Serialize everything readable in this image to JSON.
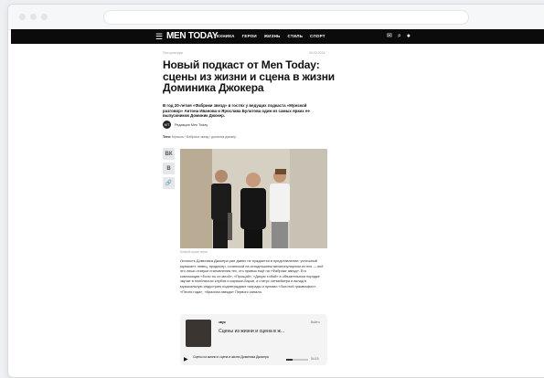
{
  "site": {
    "logo": "MEN TODAY",
    "menu": [
      "ТЕХНИКА",
      "ГЕРОИ",
      "ЖИЗНЬ",
      "СТИЛЬ",
      "СПОРТ"
    ]
  },
  "icons": {
    "burger": "menu-icon",
    "mail": "mail-icon",
    "search": "search-icon",
    "user": "user-icon"
  },
  "article": {
    "breadcrumb": "Поп-культура",
    "date": "09.03.2024",
    "title": "Новый подкаст от Men Today: сцены из жизни и сцена в жизни Доминика Джокера",
    "lead": "В год 20-летия «Фабрики звезд» в гостях у ведущих подкаста «Мужской разговор» Антона Иванова и Ярослава Булатова один из самых ярких ее выпускников Доминик Джокер.",
    "author_initials": "MT",
    "author": "Редакция Men Today",
    "tags_label": "Теги:",
    "tags": "Музыка / Фабрика звезд / доминик джокер",
    "photo_caption": "Личный архив героя",
    "body": "Личность Доминика Джокера уже давно не нуждается в представлении: успешный музыкант, певец, продюсер, сочинской на сегодняшнем мегапопулярном из них — всё это лишь отзвуки становления тех, кто привык ещё на «Фабрике звезд». Его композиции «Если ты со мной», «Прощай», «Дикую тобой» в обязательном порядке звучат в плейлистах клубов и караоке-баров, а статус хитмейкера и вклад в музыкальную индустрию подтверждают награды и премии «Золотой граммофон», «Песня года», «Красная звезда» Первого канала."
  },
  "share": [
    "ВК",
    "В",
    "🔗"
  ],
  "player": {
    "brand": "звук",
    "external": "Войти",
    "title": "Сцены из жизни и сцена в ж...",
    "episode": "Сцены из жизни и сцена в жизни Доминика Джокера",
    "duration": "54:15"
  }
}
